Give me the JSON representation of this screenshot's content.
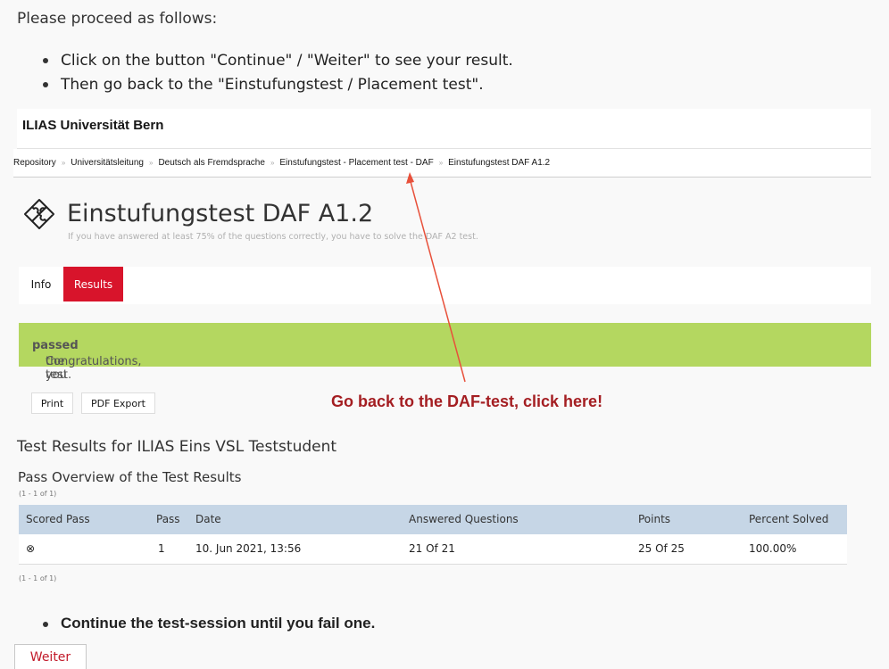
{
  "intro": {
    "text": "Please proceed as follows:",
    "bullets": [
      "Click on the button \"Continue\" / \"Weiter\" to see your result.",
      "Then go back to the \"Einstufungstest / Placement test\"."
    ]
  },
  "header": {
    "title": "ILIAS Universität Bern"
  },
  "breadcrumb": [
    "Repository",
    "Universitätsleitung",
    "Deutsch als Fremdsprache",
    "Einstufungstest - Placement test - DAF",
    "Einstufungstest DAF A1.2"
  ],
  "page": {
    "title": "Einstufungstest DAF A1.2",
    "description": "If you have answered at least 75% of the questions correctly, you have to solve the DAF A2 test.",
    "icon": "puzzle-icon"
  },
  "tabs": {
    "info": "Info",
    "results": "Results"
  },
  "alert": {
    "prefix": "Congratulations, you ",
    "bold": "passed",
    "suffix": " the test."
  },
  "toolbar": {
    "print": "Print",
    "pdf_export": "PDF Export"
  },
  "annotation": "Go back to the DAF-test, click here!",
  "results": {
    "title": "Test Results for ILIAS Eins VSL Teststudent",
    "overview_title": "Pass Overview of the Test Results",
    "range_top": "(1 - 1 of 1)",
    "range_bottom": "(1 - 1 of 1)",
    "columns": [
      "Scored Pass",
      "Pass",
      "Date",
      "Answered Questions",
      "Points",
      "Percent Solved"
    ],
    "rows": [
      [
        "⊗",
        "1",
        "10. Jun 2021, 13:56",
        "21 Of 21",
        "25 Of 25",
        "100.00%"
      ]
    ]
  },
  "final_instruction": "Continue the test-session until you fail one.",
  "weiter_button": "Weiter",
  "colors": {
    "accent_red": "#d8142b",
    "success_green": "#b4d760",
    "table_header": "#c6d6e6",
    "annotation_red": "#a41e22"
  }
}
